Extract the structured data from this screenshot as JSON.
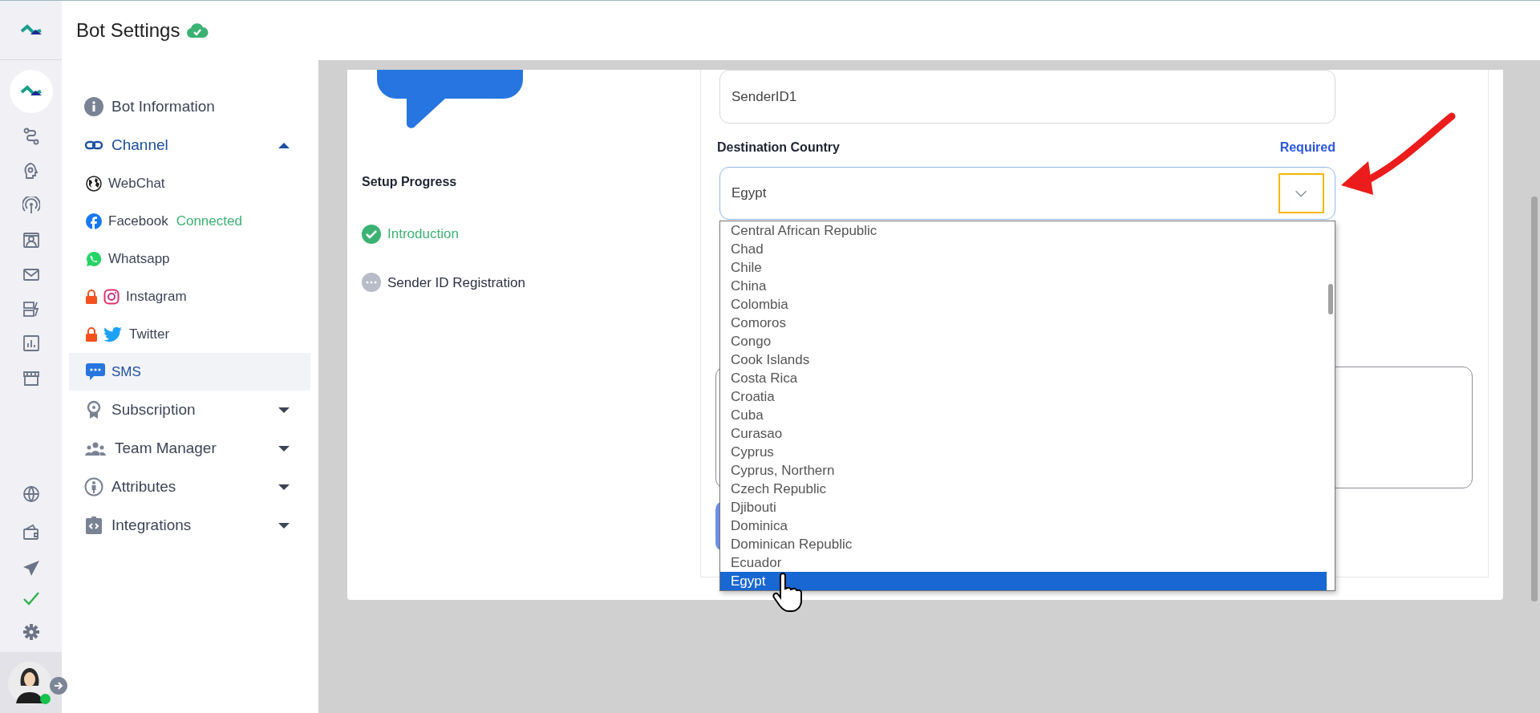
{
  "header": {
    "title": "Bot Settings"
  },
  "sidebar": {
    "items": [
      {
        "kind": "link",
        "label": "Bot Information"
      },
      {
        "kind": "group",
        "label": "Channel",
        "expanded": true,
        "children": [
          {
            "label": "WebChat",
            "selected": false,
            "locked": false
          },
          {
            "label": "Facebook",
            "status": "Connected",
            "selected": false,
            "locked": false
          },
          {
            "label": "Whatsapp",
            "selected": false,
            "locked": false
          },
          {
            "label": "Instagram",
            "selected": false,
            "locked": true
          },
          {
            "label": "Twitter",
            "selected": false,
            "locked": true
          },
          {
            "label": "SMS",
            "selected": true,
            "locked": false
          }
        ]
      },
      {
        "kind": "group",
        "label": "Subscription",
        "expanded": false
      },
      {
        "kind": "group",
        "label": "Team Manager",
        "expanded": false
      },
      {
        "kind": "group",
        "label": "Attributes",
        "expanded": false
      },
      {
        "kind": "group",
        "label": "Integrations",
        "expanded": false
      }
    ]
  },
  "setup_progress": {
    "title": "Setup Progress",
    "steps": [
      {
        "label": "Introduction",
        "done": true
      },
      {
        "label": "Sender ID Registration",
        "done": false
      }
    ]
  },
  "form": {
    "sender_id": {
      "value": "SenderID1"
    },
    "destination_country": {
      "label": "Destination Country",
      "required": "Required",
      "value": "Egypt",
      "expanded": true,
      "options": [
        {
          "label": "Central African Republic",
          "selected": false
        },
        {
          "label": "Chad",
          "selected": false
        },
        {
          "label": "Chile",
          "selected": false
        },
        {
          "label": "China",
          "selected": false
        },
        {
          "label": "Colombia",
          "selected": false
        },
        {
          "label": "Comoros",
          "selected": false
        },
        {
          "label": "Congo",
          "selected": false
        },
        {
          "label": "Cook Islands",
          "selected": false
        },
        {
          "label": "Costa Rica",
          "selected": false
        },
        {
          "label": "Croatia",
          "selected": false
        },
        {
          "label": "Cuba",
          "selected": false
        },
        {
          "label": "Curasao",
          "selected": false
        },
        {
          "label": "Cyprus",
          "selected": false
        },
        {
          "label": "Cyprus, Northern",
          "selected": false
        },
        {
          "label": "Czech Republic",
          "selected": false
        },
        {
          "label": "Djibouti",
          "selected": false
        },
        {
          "label": "Dominica",
          "selected": false
        },
        {
          "label": "Dominican Republic",
          "selected": false
        },
        {
          "label": "Ecuador",
          "selected": false
        },
        {
          "label": "Egypt",
          "selected": true
        }
      ]
    }
  }
}
